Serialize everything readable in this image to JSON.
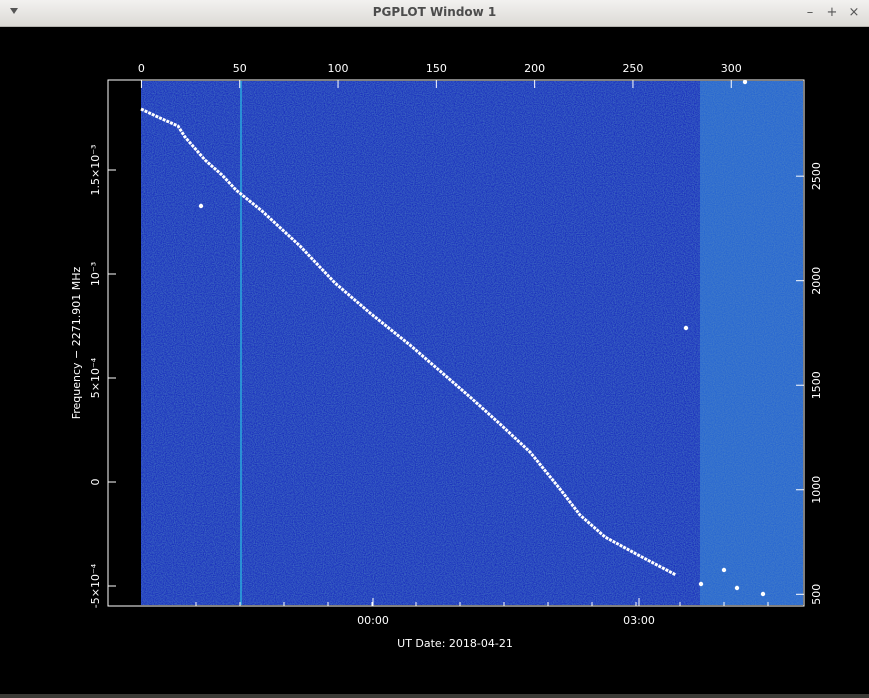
{
  "window": {
    "title": "PGPLOT Window 1",
    "buttons": {
      "minimize": "–",
      "maximize": "+",
      "close": "×"
    }
  },
  "chart_data": {
    "type": "heatmap",
    "xlabel": "UT Date: 2018-04-21",
    "ylabel": "Frequency − 2271.901 MHz",
    "top_axis_ticks": [
      0,
      50,
      100,
      150,
      200,
      250,
      300
    ],
    "bottom_axis_ticks": [
      "00:00",
      "03:00"
    ],
    "left_axis_ticks": [
      "-5×10⁻⁴",
      "0",
      "5×10⁻⁴",
      "10⁻³",
      "1.5×10⁻³"
    ],
    "right_axis_ticks": [
      500,
      1000,
      1500,
      2000,
      2500
    ],
    "top_axis_range": [
      -17,
      337
    ],
    "right_axis_range": [
      444,
      2960
    ],
    "signal_trace_description": "Doppler track of a signal in a frequency-time waterfall",
    "colors": {
      "background_low": "#1428b4",
      "background_high": "#2a6ad8",
      "signal": "#ffffff"
    }
  }
}
